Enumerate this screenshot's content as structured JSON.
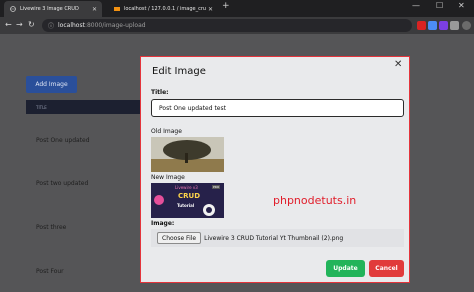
{
  "browser": {
    "tabs": [
      {
        "label": "Livewire 3 Image CRUD",
        "active": true
      },
      {
        "label": "localhost / 127.0.0.1 / image_cru",
        "active": false
      }
    ],
    "new_tab": "+",
    "window_controls": {
      "minimize": "—",
      "maximize": "☐",
      "close": "✕"
    },
    "url_host": "localhost",
    "url_path": ":8000/image-upload",
    "extension_colors": [
      "#d92323",
      "#4c8df5",
      "#7b3fe4",
      "#999999",
      "#6b6b6b"
    ]
  },
  "page": {
    "add_button": "Add Image",
    "table_header": "TITLE",
    "rows": [
      "Post One updated",
      "Post two updated",
      "Post three",
      "Post Four"
    ]
  },
  "modal": {
    "title": "Edit Image",
    "close": "✕",
    "title_label": "Title:",
    "title_value": "Post One updated test",
    "old_image_label": "Old Image",
    "new_image_label": "New Image",
    "thumbnail": {
      "line1": "Livewire v3",
      "line2": "CRUD",
      "line3": "Tutorial",
      "badge": "PRO"
    },
    "brand_text": "phpnodetuts.in",
    "image_label": "Image:",
    "choose_file": "Choose File",
    "file_name": "Livewire 3 CRUD Tutorial Yt Thumbnail (2).png",
    "update_button": "Update",
    "cancel_button": "Cancel",
    "accent": "#e4343b",
    "update_color": "#22b45a",
    "cancel_color": "#e13b3b"
  }
}
